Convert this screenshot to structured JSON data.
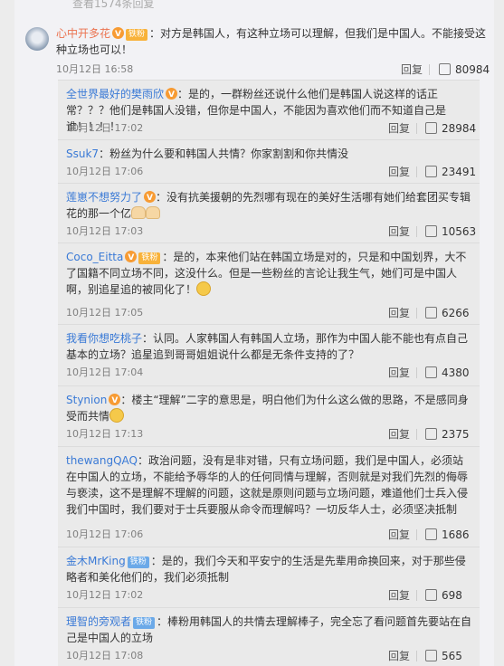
{
  "header_link": "查看1574条回复",
  "main_comment": {
    "username": "心中开多花",
    "badge": "铁粉",
    "text": "：对方是韩国人，有这种立场可以理解，但我们是中国人。不能接受这种立场也可以！",
    "time": "10月12日 16:58",
    "reply_label": "回复",
    "likes": "80984"
  },
  "replies": [
    {
      "username": "全世界最好的樊雨欣",
      "text": "：是的，一群粉丝还说什么他们是韩国人说这样的话正常？？？他们是韩国人没错，但你是中国人，不能因为喜欢他们而不知道自己是谁！！！！",
      "time": "10月12日 17:02",
      "reply_label": "回复",
      "likes": "28984"
    },
    {
      "username": "Ssuk7",
      "text": "：粉丝为什么要和韩国人共情？你家割割和你共情没",
      "time": "10月12日 17:06",
      "reply_label": "回复",
      "likes": "23491"
    },
    {
      "username": "莲崽不想努力了",
      "text": "：没有抗美援朝的先烈哪有现在的美好生活哪有她们给套团买专辑花的那一个亿",
      "time": "10月12日 17:03",
      "reply_label": "回复",
      "likes": "10563"
    },
    {
      "username": "Coco_Eitta",
      "badge": "铁粉",
      "text": "：是的，本来他们站在韩国立场是对的，只是和中国划界，大不了国籍不同立场不同，这没什么。但是一些粉丝的言论让我生气，她们可是中国人啊，别追星追的被同化了！",
      "time": "10月12日 17:05",
      "reply_label": "回复",
      "likes": "6266"
    },
    {
      "username": "我看你想吃桃子",
      "text": "：认同。人家韩国人有韩国人立场，那作为中国人能不能也有点自己基本的立场？追星追到哥哥姐姐说什么都是无条件支持的了？",
      "time": "10月12日 17:04",
      "reply_label": "回复",
      "likes": "4380"
    },
    {
      "username": "Stynion",
      "text": "：楼主“理解”二字的意思是，明白他们为什么这么做的思路，不是感同身受而共情",
      "time": "10月12日 17:13",
      "reply_label": "回复",
      "likes": "2375"
    },
    {
      "username": "thewangQAQ",
      "text": "：政治问题，没有是非对错，只有立场问题，我们是中国人，必须站在中国人的立场，不能给予辱华的人的任何同情与理解，否则就是对我们先烈的侮辱与亵渎，这不是理解不理解的问题，这就是原则问题与立场问题，难道他们士兵入侵我们中国时，我们要对于士兵要服从命令而理解吗？一切反华人士，必须坚决抵制",
      "time": "10月12日 17:06",
      "reply_label": "回复",
      "likes": "1686"
    },
    {
      "username": "金木MrKing",
      "badge": "铁粉",
      "text": "：是的，我们今天和平安宁的生活是先辈用命换回来，对于那些侵略者和美化他们的，我们必须抵制",
      "time": "10月12日 17:02",
      "reply_label": "回复",
      "likes": "698"
    },
    {
      "username": "理智的旁观者",
      "badge": "铁粉",
      "text": "：棒粉用韩国人的共情去理解棒子，完全忘了看问题首先要站在自己是中国人的立场",
      "time": "10月12日 17:08",
      "reply_label": "回复",
      "likes": "565"
    }
  ]
}
